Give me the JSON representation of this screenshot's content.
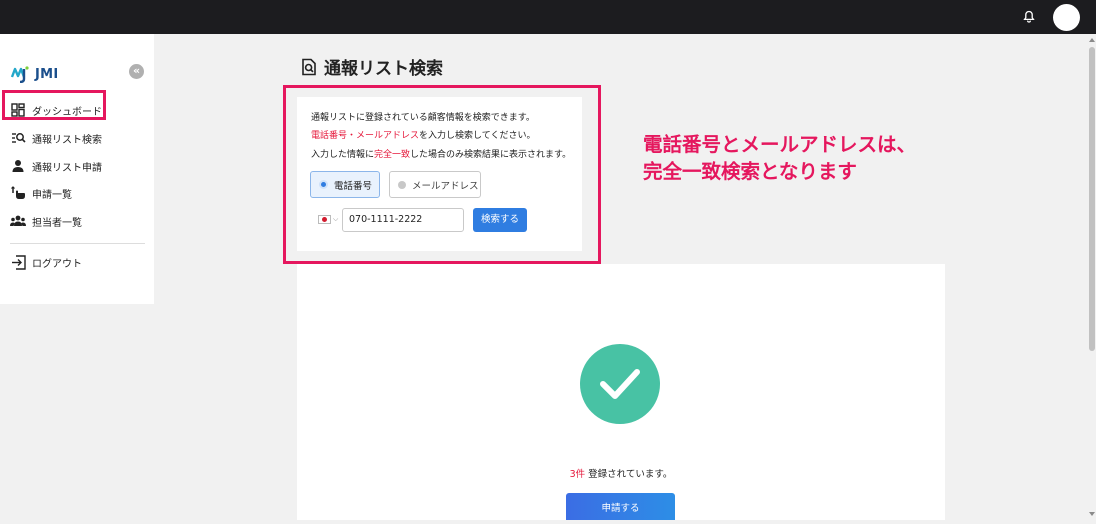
{
  "topbar": {
    "bell_icon": "bell-icon",
    "avatar": "user-avatar"
  },
  "sidebar": {
    "logo_text": "JMI",
    "collapse_glyph": "«",
    "items": [
      {
        "label": "ダッシュボード",
        "icon": "dashboard-grid-icon"
      },
      {
        "label": "通報リスト検索",
        "icon": "list-search-icon"
      },
      {
        "label": "通報リスト申請",
        "icon": "person-icon"
      },
      {
        "label": "申請一覧",
        "icon": "hand-pointer-icon"
      },
      {
        "label": "担当者一覧",
        "icon": "group-icon"
      }
    ],
    "logout_label": "ログアウト"
  },
  "page": {
    "title": "通報リスト検索"
  },
  "search": {
    "desc_line1": "通報リストに登録されている顧客情報を検索できます。",
    "desc_line2_red": "電話番号・メールアドレス",
    "desc_line2_rest": "を入力し検索してください。",
    "desc_line3_pre": "入力した情報に",
    "desc_line3_red": "完全一致",
    "desc_line3_post": "した場合のみ検索結果に表示されます。",
    "option_phone": "電話番号",
    "option_mail": "メールアドレス",
    "selected_option": "電話番号",
    "country_flag": "japan-flag",
    "phone_value": "070-1111-2222",
    "search_button": "検索する"
  },
  "annotation": {
    "line1": "電話番号とメールアドレスは、",
    "line2": "完全一致検索となります"
  },
  "result": {
    "count_red": "3件",
    "count_text": " 登録されています。",
    "apply_button": "申請する"
  },
  "colors": {
    "accent": "#2f7de1",
    "highlight": "#e5175e",
    "success": "#48c2a4",
    "topbar": "#1c1c1f"
  }
}
